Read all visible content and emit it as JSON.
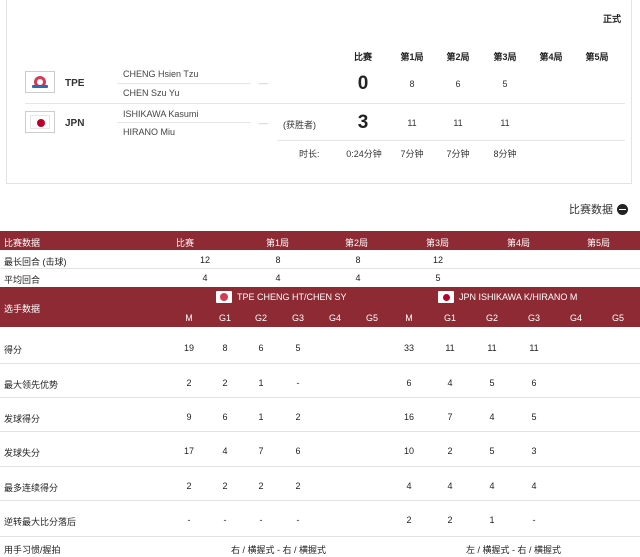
{
  "match": {
    "status": "正式",
    "columns": [
      "比赛",
      "第1局",
      "第2局",
      "第3局",
      "第4局",
      "第5局"
    ],
    "teams": [
      {
        "code": "TPE",
        "players": [
          "CHENG Hsien Tzu",
          "CHEN Szu Yu"
        ],
        "dash": "—",
        "winner_label": "",
        "score": "0",
        "games": [
          "8",
          "6",
          "5",
          "",
          ""
        ]
      },
      {
        "code": "JPN",
        "players": [
          "ISHIKAWA Kasumi",
          "HIRANO Miu"
        ],
        "dash": "—",
        "winner_label": "(获胜者)",
        "score": "3",
        "games": [
          "11",
          "11",
          "11",
          "",
          ""
        ]
      }
    ],
    "duration": {
      "label": "时长:",
      "values": [
        "0:24分钟",
        "7分钟",
        "7分钟",
        "8分钟",
        "",
        ""
      ]
    }
  },
  "stats_toggle": {
    "label": "比赛数据"
  },
  "match_stats": {
    "header": [
      "比赛数据",
      "比赛",
      "第1局",
      "第2局",
      "第3局",
      "第4局",
      "第5局"
    ],
    "rows": [
      {
        "label": "最长回合 (击球)",
        "values": [
          "12",
          "8",
          "8",
          "12",
          "",
          ""
        ]
      },
      {
        "label": "平均回合",
        "values": [
          "4",
          "4",
          "4",
          "5",
          "",
          ""
        ]
      }
    ]
  },
  "player_stats": {
    "title": "选手数据",
    "team_a": "TPE CHENG HT/CHEN SY",
    "team_b": "JPN ISHIKAWA K/HIRANO M",
    "subcols": [
      "M",
      "G1",
      "G2",
      "G3",
      "G4",
      "G5",
      "M",
      "G1",
      "G2",
      "G3",
      "G4",
      "G5"
    ],
    "rows": [
      {
        "label": "得分",
        "values": [
          "19",
          "8",
          "6",
          "5",
          "",
          "",
          "33",
          "11",
          "11",
          "11",
          "",
          ""
        ]
      },
      {
        "label": "最大领先优势",
        "values": [
          "2",
          "2",
          "1",
          "-",
          "",
          "",
          "6",
          "4",
          "5",
          "6",
          "",
          ""
        ]
      },
      {
        "label": "发球得分",
        "values": [
          "9",
          "6",
          "1",
          "2",
          "",
          "",
          "16",
          "7",
          "4",
          "5",
          "",
          ""
        ]
      },
      {
        "label": "发球失分",
        "values": [
          "17",
          "4",
          "7",
          "6",
          "",
          "",
          "10",
          "2",
          "5",
          "3",
          "",
          ""
        ]
      },
      {
        "label": "最多连续得分",
        "values": [
          "2",
          "2",
          "2",
          "2",
          "",
          "",
          "4",
          "4",
          "4",
          "4",
          "",
          ""
        ]
      },
      {
        "label": "逆转最大比分落后",
        "values": [
          "-",
          "-",
          "-",
          "-",
          "",
          "",
          "2",
          "2",
          "1",
          "-",
          "",
          ""
        ]
      }
    ],
    "grip": {
      "label": "用手习惯/握拍",
      "team_a": "右 / 横握式 - 右 / 横握式",
      "team_b": "左 / 横握式 - 右 / 横握式"
    }
  }
}
